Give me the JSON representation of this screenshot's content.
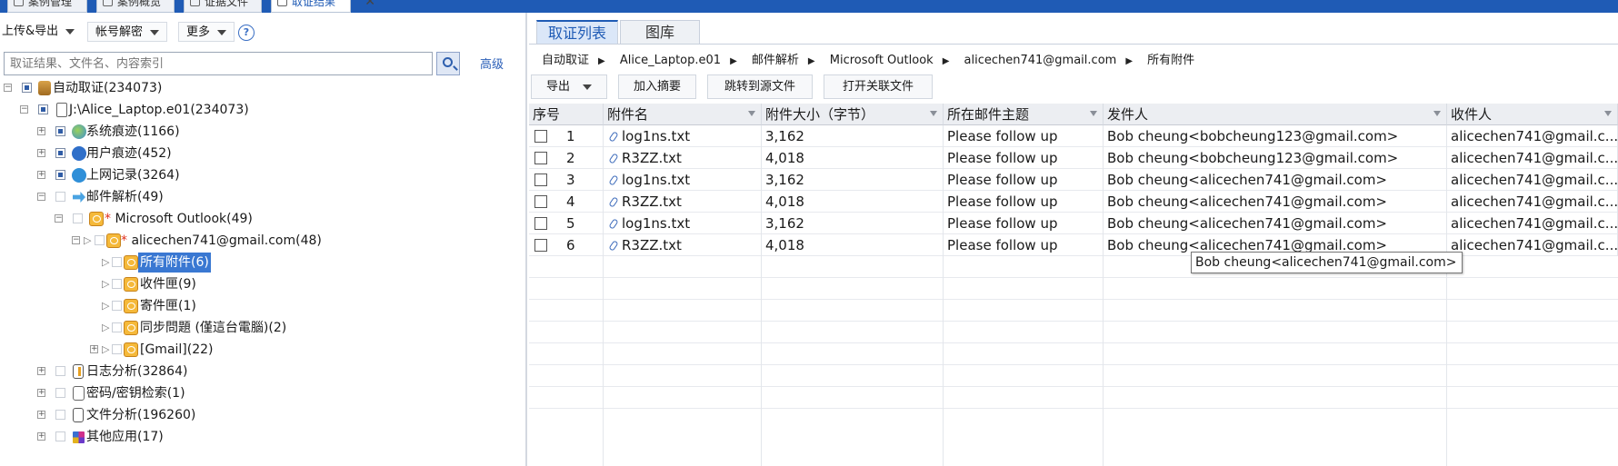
{
  "top_tabs": [
    {
      "label": "案例管理",
      "active": false
    },
    {
      "label": "案例概览",
      "active": false
    },
    {
      "label": "证据文件",
      "active": false
    },
    {
      "label": "取证结果",
      "active": true
    }
  ],
  "left": {
    "toolbar": {
      "upload_export": "上传&导出",
      "account_decrypt": "帐号解密",
      "more": "更多",
      "help": "?"
    },
    "search": {
      "placeholder": "取证结果、文件名、内容索引",
      "advanced": "高级"
    },
    "tree": [
      {
        "label": "自动取证(234073)"
      },
      {
        "label": "J:\\Alice_Laptop.e01(234073)"
      },
      {
        "label": "系统痕迹(1166)"
      },
      {
        "label": "用户痕迹(452)"
      },
      {
        "label": "上网记录(3264)"
      },
      {
        "label": "邮件解析(49)"
      },
      {
        "label": "Microsoft Outlook(49)",
        "star": "*"
      },
      {
        "label": "alicechen741@gmail.com(48)",
        "star": "*"
      },
      {
        "label": "所有附件(6)",
        "selected": true
      },
      {
        "label": "收件匣(9)"
      },
      {
        "label": "寄件匣(1)"
      },
      {
        "label": "同步問題 (僅這台電腦)(2)"
      },
      {
        "label": "[Gmail](22)"
      },
      {
        "label": "日志分析(32864)"
      },
      {
        "label": "密码/密钥检索(1)"
      },
      {
        "label": "文件分析(196260)"
      },
      {
        "label": "其他应用(17)"
      }
    ]
  },
  "right": {
    "tabs": [
      {
        "label": "取证列表",
        "active": true
      },
      {
        "label": "图库",
        "active": false
      }
    ],
    "breadcrumb": [
      "自动取证",
      "Alice_Laptop.e01",
      "邮件解析",
      "Microsoft Outlook",
      "alicechen741@gmail.com",
      "所有附件"
    ],
    "actions": {
      "export": "导出",
      "add_summary": "加入摘要",
      "jump_source": "跳转到源文件",
      "open_related": "打开关联文件"
    },
    "table": {
      "columns": [
        "序号",
        "附件名",
        "附件大小（字节）",
        "所在邮件主题",
        "发件人",
        "收件人"
      ],
      "rows": [
        {
          "no": "1",
          "name": "log1ns.txt",
          "size": "3,162",
          "subject": "Please follow up",
          "from": "Bob cheung<bobcheung123@gmail.com>",
          "to": "alicechen741@gmail.c..."
        },
        {
          "no": "2",
          "name": "R3ZZ.txt",
          "size": "4,018",
          "subject": "Please follow up",
          "from": "Bob cheung<bobcheung123@gmail.com>",
          "to": "alicechen741@gmail.c..."
        },
        {
          "no": "3",
          "name": "log1ns.txt",
          "size": "3,162",
          "subject": "Please follow up",
          "from": "Bob cheung<alicechen741@gmail.com>",
          "to": "alicechen741@gmail.c..."
        },
        {
          "no": "4",
          "name": "R3ZZ.txt",
          "size": "4,018",
          "subject": "Please follow up",
          "from": "Bob cheung<alicechen741@gmail.com>",
          "to": "alicechen741@gmail.c..."
        },
        {
          "no": "5",
          "name": "log1ns.txt",
          "size": "3,162",
          "subject": "Please follow up",
          "from": "Bob cheung<alicechen741@gmail.com>",
          "to": "alicechen741@gmail.c..."
        },
        {
          "no": "6",
          "name": "R3ZZ.txt",
          "size": "4,018",
          "subject": "Please follow up",
          "from": "Bob cheung<alicechen741@gmail.com>",
          "to": "alicechen741@gmail.c..."
        }
      ]
    },
    "tooltip": "Bob cheung<alicechen741@gmail.com>"
  },
  "colors": {
    "accent": "#1f5bb5",
    "selection": "#3a78d2",
    "link": "#2b5fb8"
  }
}
